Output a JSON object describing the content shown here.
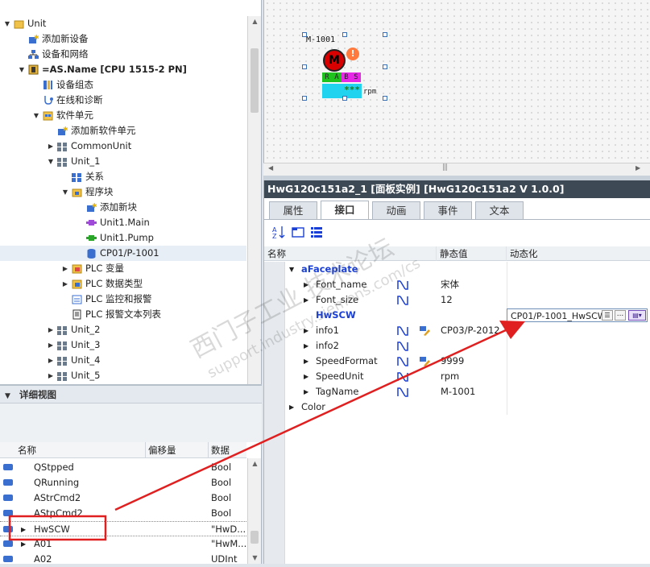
{
  "project_tree": {
    "items": [
      {
        "label": "Unit",
        "toggle": "▼",
        "icon": "folder-icon"
      },
      {
        "label": "添加新设备",
        "toggle": "",
        "icon": "add-device-icon"
      },
      {
        "label": "设备和网络",
        "toggle": "",
        "icon": "network-icon"
      },
      {
        "label": "=AS.Name [CPU 1515-2 PN]",
        "toggle": "▼",
        "icon": "cpu-icon"
      },
      {
        "label": "设备组态",
        "toggle": "",
        "icon": "device-config-icon"
      },
      {
        "label": "在线和诊断",
        "toggle": "",
        "icon": "diagnostics-icon"
      },
      {
        "label": "软件单元",
        "toggle": "▼",
        "icon": "software-units-icon"
      },
      {
        "label": "添加新软件单元",
        "toggle": "",
        "icon": "add-unit-icon"
      },
      {
        "label": "CommonUnit",
        "toggle": "▶",
        "icon": "unit-icon"
      },
      {
        "label": "Unit_1",
        "toggle": "▼",
        "icon": "unit-icon"
      },
      {
        "label": "关系",
        "toggle": "",
        "icon": "relations-icon"
      },
      {
        "label": "程序块",
        "toggle": "▼",
        "icon": "program-blocks-icon"
      },
      {
        "label": "添加新块",
        "toggle": "",
        "icon": "add-block-icon"
      },
      {
        "label": "Unit1.Main",
        "toggle": "",
        "icon": "ob-block-icon"
      },
      {
        "label": "Unit1.Pump",
        "toggle": "",
        "icon": "fb-block-icon"
      },
      {
        "label": "CP01/P-1001",
        "toggle": "",
        "icon": "db-block-icon"
      },
      {
        "label": "PLC 变量",
        "toggle": "▶",
        "icon": "plc-tags-icon"
      },
      {
        "label": "PLC 数据类型",
        "toggle": "▶",
        "icon": "plc-datatypes-icon"
      },
      {
        "label": "PLC 监控和报警",
        "toggle": "",
        "icon": "plc-alarms-icon"
      },
      {
        "label": "PLC 报警文本列表",
        "toggle": "",
        "icon": "alarm-text-icon"
      },
      {
        "label": "Unit_2",
        "toggle": "▶",
        "icon": "unit-icon"
      },
      {
        "label": "Unit_3",
        "toggle": "▶",
        "icon": "unit-icon"
      },
      {
        "label": "Unit_4",
        "toggle": "▶",
        "icon": "unit-icon"
      },
      {
        "label": "Unit_5",
        "toggle": "▶",
        "icon": "unit-icon"
      }
    ]
  },
  "detail_view": {
    "title": "详细视图",
    "columns": {
      "name": "名称",
      "offset": "偏移量",
      "data": "数据"
    },
    "rows": [
      {
        "name": "QStpped",
        "data": "Bool",
        "toggle": ""
      },
      {
        "name": "QRunning",
        "data": "Bool",
        "toggle": ""
      },
      {
        "name": "AStrCmd2",
        "data": "Bool",
        "toggle": ""
      },
      {
        "name": "AStpCmd2",
        "data": "Bool",
        "toggle": ""
      },
      {
        "name": "HwSCW",
        "data": "\"HwD...",
        "toggle": "▶"
      },
      {
        "name": "A01",
        "data": "\"HwM...",
        "toggle": "▶"
      },
      {
        "name": "A02",
        "data": "UDInt",
        "toggle": ""
      }
    ]
  },
  "canvas": {
    "tag_label": "M-1001",
    "motor_letter": "M",
    "status_letters": [
      "R",
      "A",
      "B",
      "S"
    ],
    "speed_placeholder": "***",
    "speed_unit": "rpm",
    "warning_glyph": "!"
  },
  "inspector": {
    "title": "HwG120c151a2_1 [面板实例] [HwG120c151a2 V 1.0.0]",
    "tabs": [
      {
        "label": "属性",
        "active": false
      },
      {
        "label": "接口",
        "active": true
      },
      {
        "label": "动画",
        "active": false
      },
      {
        "label": "事件",
        "active": false
      },
      {
        "label": "文本",
        "active": false
      }
    ],
    "columns": {
      "name": "名称",
      "static": "静态值",
      "dynamic": "动态化"
    },
    "rows": [
      {
        "name": "aFaceplate",
        "toggle": "▼",
        "level": 0,
        "bold": true,
        "static": "",
        "link": false,
        "edit": false
      },
      {
        "name": "Font_name",
        "toggle": "▶",
        "level": 1,
        "bold": false,
        "static": "宋体",
        "link": true,
        "edit": false
      },
      {
        "name": "Font_size",
        "toggle": "▶",
        "level": 1,
        "bold": false,
        "static": "12",
        "link": true,
        "edit": false
      },
      {
        "name": "HwSCW",
        "toggle": "",
        "level": 1,
        "bold": true,
        "static": "",
        "link": false,
        "edit": false,
        "dynamic_value": "CP01/P-1001_HwSCW"
      },
      {
        "name": "info1",
        "toggle": "▶",
        "level": 1,
        "bold": false,
        "static": "CP03/P-2012",
        "link": true,
        "edit": true
      },
      {
        "name": "info2",
        "toggle": "▶",
        "level": 1,
        "bold": false,
        "static": "",
        "link": true,
        "edit": false
      },
      {
        "name": "SpeedFormat",
        "toggle": "▶",
        "level": 1,
        "bold": false,
        "static": "9999",
        "link": true,
        "edit": true
      },
      {
        "name": "SpeedUnit",
        "toggle": "▶",
        "level": 1,
        "bold": false,
        "static": "rpm",
        "link": true,
        "edit": false
      },
      {
        "name": "TagName",
        "toggle": "▶",
        "level": 1,
        "bold": false,
        "static": "M-1001",
        "link": true,
        "edit": false
      },
      {
        "name": "Color",
        "toggle": "▶",
        "level": 0,
        "bold": false,
        "static": "",
        "link": false,
        "edit": false
      }
    ]
  },
  "watermark": {
    "line1": "西门子工业 技术论坛",
    "line2": "support.industry.siemens.com/cs"
  },
  "colors": {
    "accent_blue": "#1a3fd6",
    "title_bar": "#3d4a56",
    "annotation_red": "#e02020",
    "motor_red": "#d80000",
    "warning_orange": "#ff7a3c",
    "speed_cyan": "#22d3f0"
  }
}
